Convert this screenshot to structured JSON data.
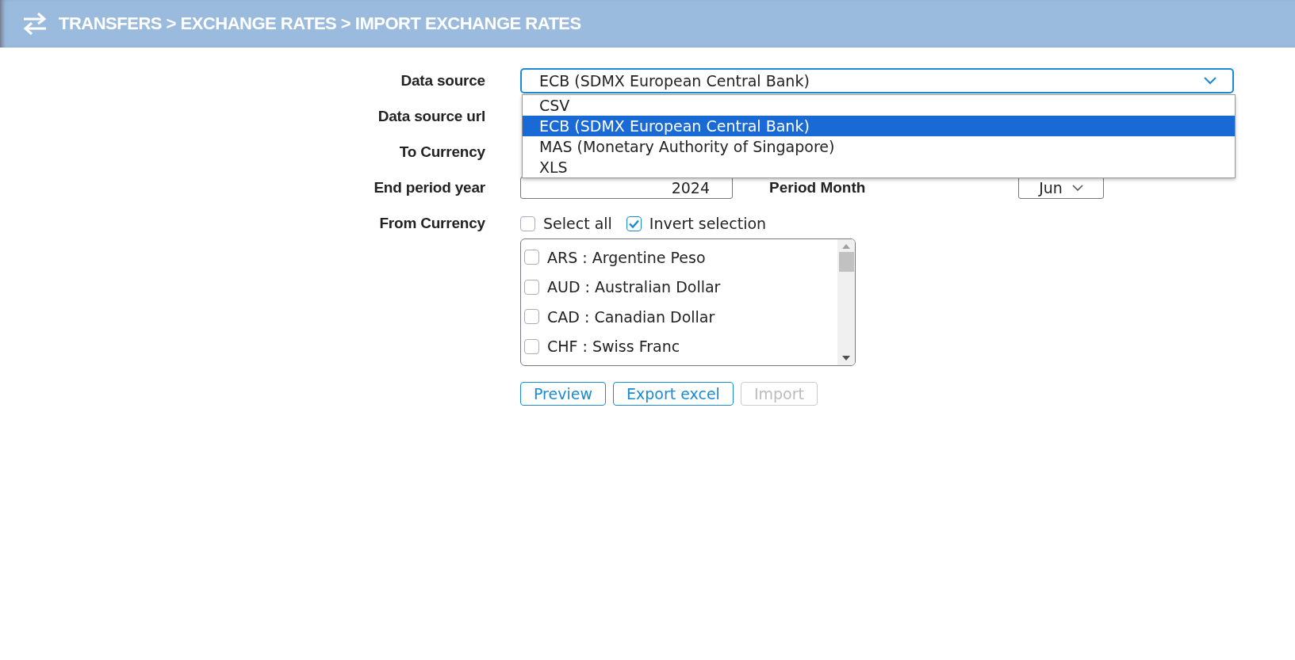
{
  "header": {
    "title": "TRANSFERS > EXCHANGE RATES > IMPORT EXCHANGE RATES"
  },
  "data_source": {
    "label": "Data source",
    "value": "ECB (SDMX European Central Bank)",
    "expanded": true,
    "options": [
      {
        "label": "CSV",
        "selected": false
      },
      {
        "label": "ECB (SDMX European Central Bank)",
        "selected": true
      },
      {
        "label": "MAS (Monetary Authority of Singapore)",
        "selected": false
      },
      {
        "label": "XLS",
        "selected": false
      }
    ]
  },
  "data_source_url": {
    "label": "Data source url"
  },
  "to_currency": {
    "label": "To Currency"
  },
  "end_period_year": {
    "label": "End period year",
    "value": "2024"
  },
  "period_month": {
    "label": "Period Month",
    "value": "Jun"
  },
  "from_currency": {
    "label": "From Currency",
    "select_all": {
      "label": "Select all",
      "checked": false
    },
    "invert_selection": {
      "label": "Invert selection",
      "checked": true
    },
    "currencies": [
      {
        "label": "ARS : Argentine Peso",
        "checked": false
      },
      {
        "label": "AUD : Australian Dollar",
        "checked": false
      },
      {
        "label": "CAD : Canadian Dollar",
        "checked": false
      },
      {
        "label": "CHF : Swiss Franc",
        "checked": false
      }
    ]
  },
  "buttons": [
    {
      "label": "Preview",
      "disabled": false
    },
    {
      "label": "Export excel",
      "disabled": false
    },
    {
      "label": "Import",
      "disabled": true
    }
  ]
}
